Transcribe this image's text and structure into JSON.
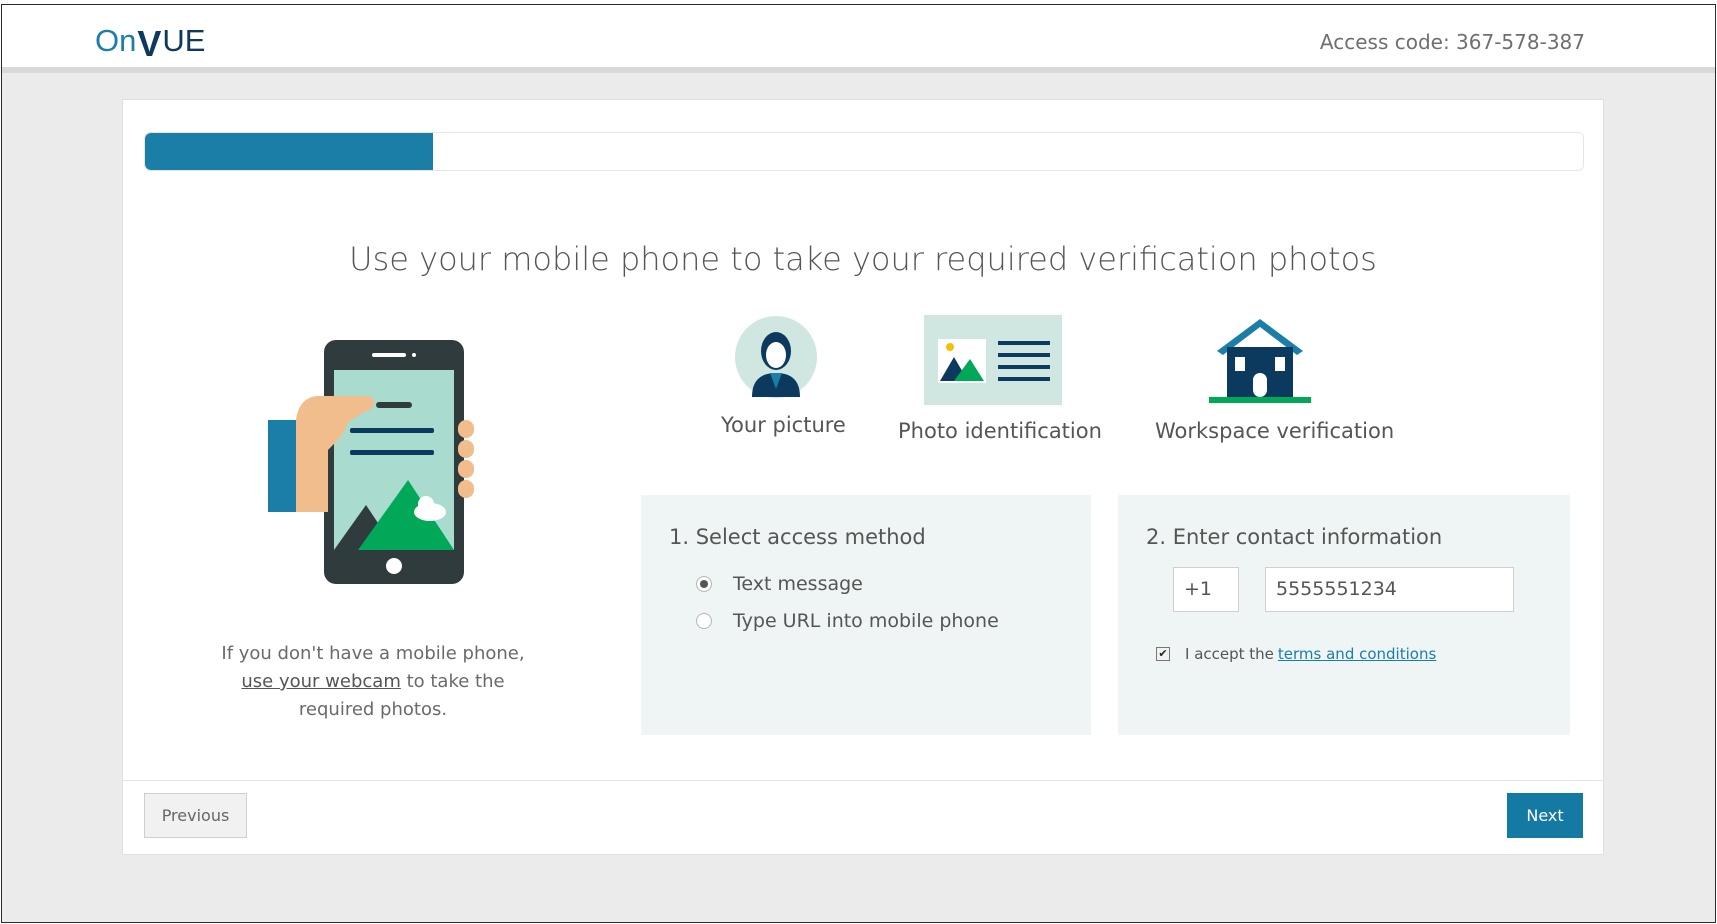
{
  "header": {
    "logo": {
      "on": "On",
      "v": "V",
      "ue": "UE"
    },
    "access_code": "Access code: 367-578-387"
  },
  "progress": {
    "fraction": 0.2
  },
  "main": {
    "heading": "Use your mobile phone to take your required verification photos",
    "webcam_note": {
      "prefix": "If you don't have a mobile phone, ",
      "link": "use your webcam",
      "suffix": " to take the required photos."
    },
    "steps": [
      {
        "label": "Your picture",
        "icon": "person-icon"
      },
      {
        "label": "Photo identification",
        "icon": "id-card-icon"
      },
      {
        "label": "Workspace verification",
        "icon": "house-icon"
      }
    ],
    "access_method": {
      "title": "1. Select access method",
      "options": [
        {
          "label": "Text message",
          "selected": true
        },
        {
          "label": "Type URL into mobile phone",
          "selected": false
        }
      ]
    },
    "contact": {
      "title": "2. Enter contact information",
      "country_code": "+1",
      "phone_number": "5555551234",
      "terms_prefix": "I accept the",
      "terms_link": "terms and conditions",
      "terms_checked": true
    }
  },
  "footer": {
    "previous_label": "Previous",
    "next_label": "Next"
  },
  "colors": {
    "accent": "#1b7ea6",
    "navy": "#0b3a5e",
    "panel_bg": "#eff5f4"
  }
}
